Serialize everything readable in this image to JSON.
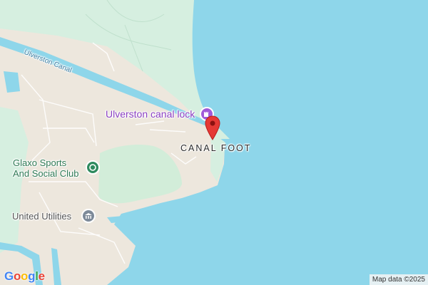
{
  "map": {
    "labels": {
      "canal": "Ulverston Canal",
      "lock": "Ulverston canal lock",
      "area": "CANAL FOOT",
      "glaxo": "Glaxo Sports\nAnd Social Club",
      "utilities": "United Utilities"
    },
    "icons": {
      "lock": "castle-icon",
      "glaxo": "sports-circle-icon",
      "utilities": "building-icon",
      "pin": "map-pin-icon"
    },
    "colors": {
      "water": "#8ed6ea",
      "land": "#ede7dd",
      "park": "#d6efe0",
      "poi_purple": "#8a3fc1",
      "poi_green": "#2f8a5e",
      "pin": "#e53935"
    },
    "attribution": "Map data ©2025",
    "brand": [
      "G",
      "o",
      "o",
      "g",
      "l",
      "e"
    ],
    "brand_colors": [
      "#4285F4",
      "#EA4335",
      "#FBBC05",
      "#4285F4",
      "#34A853",
      "#EA4335"
    ]
  }
}
